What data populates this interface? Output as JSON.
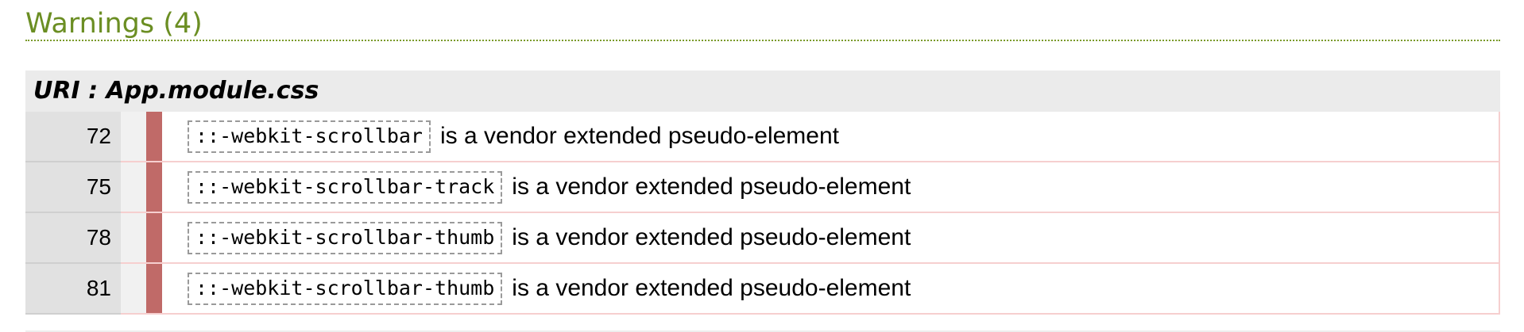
{
  "heading": {
    "text": "Warnings (4)"
  },
  "uri": {
    "text": "URI : App.module.css"
  },
  "rows": [
    {
      "line": "72",
      "code": "::-webkit-scrollbar",
      "message": "is a vendor extended pseudo-element"
    },
    {
      "line": "75",
      "code": "::-webkit-scrollbar-track",
      "message": "is a vendor extended pseudo-element"
    },
    {
      "line": "78",
      "code": "::-webkit-scrollbar-thumb",
      "message": "is a vendor extended pseudo-element"
    },
    {
      "line": "81",
      "code": "::-webkit-scrollbar-thumb",
      "message": "is a vendor extended pseudo-element"
    }
  ],
  "colors": {
    "heading": "#6b8e23",
    "severity_warning": "#c06a68",
    "uri_bar": "#ebebeb",
    "line_number_cell": "#e1e1e1"
  }
}
